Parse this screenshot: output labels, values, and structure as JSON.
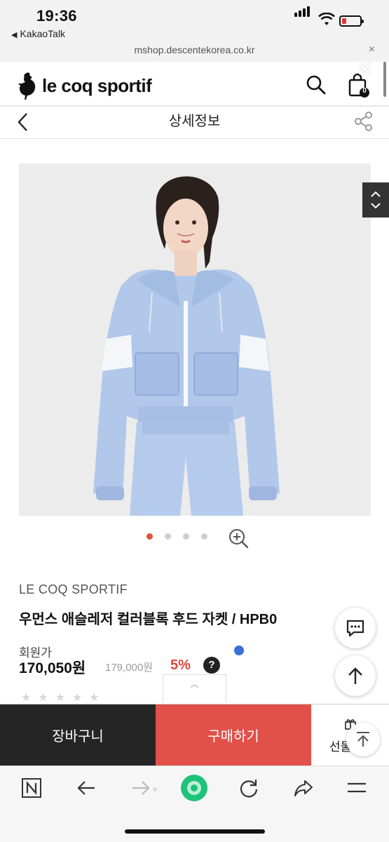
{
  "status_bar": {
    "time": "19:36",
    "back_app": "KakaoTalk",
    "url": "mshop.descentekorea.co.kr",
    "close": "×"
  },
  "header": {
    "brand_wordmark": "le coq sportif",
    "cart_count": "0",
    "overlay_close": "✕"
  },
  "subheader": {
    "title": "상세정보"
  },
  "gallery": {
    "total_dots": 4,
    "active_index": 0
  },
  "product": {
    "brand": "LE COQ SPORTIF",
    "name": "우먼스 애슬레저 컬러블록 후드 자켓 / HPB0",
    "member_price_label": "회원가",
    "price": "170,050원",
    "original_price": "179,000원",
    "discount": "5%",
    "help": "?"
  },
  "buy_bar": {
    "cart_label": "장바구니",
    "buy_label": "구매하기",
    "gift_label": "선물"
  },
  "colors": {
    "buy": "#e2504a",
    "cart": "#252525",
    "discount": "#e0453c",
    "active_dot": "#e0533c",
    "jacket": "#b2c8ea"
  },
  "icons": [
    "search-icon",
    "shopping-bag-icon",
    "back-chevron-icon",
    "share-icon",
    "chevron-up-icon",
    "chevron-down-icon",
    "zoom-in-icon",
    "chat-icon",
    "arrow-up-icon",
    "gift-icon",
    "n-app-icon",
    "browser-back-icon",
    "browser-forward-icon",
    "green-home-icon",
    "refresh-icon",
    "browser-share-icon",
    "menu-icon"
  ]
}
